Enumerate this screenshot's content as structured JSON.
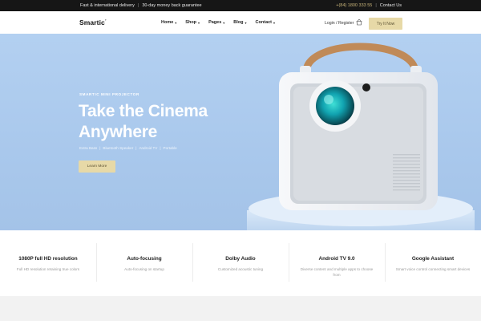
{
  "topbar": {
    "promo_1": "Fast & international delivery",
    "promo_2": "30-day money back guarantee",
    "phone": "+(84) 1800 333 55",
    "contact": "Contact Us"
  },
  "header": {
    "logo": "Smartic",
    "nav": [
      {
        "label": "Home"
      },
      {
        "label": "Shop"
      },
      {
        "label": "Pages"
      },
      {
        "label": "Blog"
      },
      {
        "label": "Contact"
      }
    ],
    "login_label": "Login / Register",
    "cta_label": "Try It Now"
  },
  "hero": {
    "eyebrow": "SMARTIC MINI PROJECTOR",
    "headline_line1": "Take the Cinema",
    "headline_line2": "Anywhere",
    "features": [
      "Extra Bass",
      "Bluetooth Speaker",
      "Android TV",
      "Portable"
    ],
    "button_label": "Learn More"
  },
  "features": [
    {
      "title": "1080P full HD resolution",
      "desc": "Full HD resolution retaining true colors"
    },
    {
      "title": "Auto-focusing",
      "desc": "Auto-focusing on startup"
    },
    {
      "title": "Dolby Audio",
      "desc": "Customized acoustic tuning"
    },
    {
      "title": "Android TV 9.0",
      "desc": "Diverse content and multiple apps to choose from"
    },
    {
      "title": "Google Assistant",
      "desc": "Smart voice control connecting smart devices"
    }
  ],
  "colors": {
    "accent": "#e7d9a7",
    "hero_bg": "#aecbee",
    "topbar_bg": "#161616"
  }
}
